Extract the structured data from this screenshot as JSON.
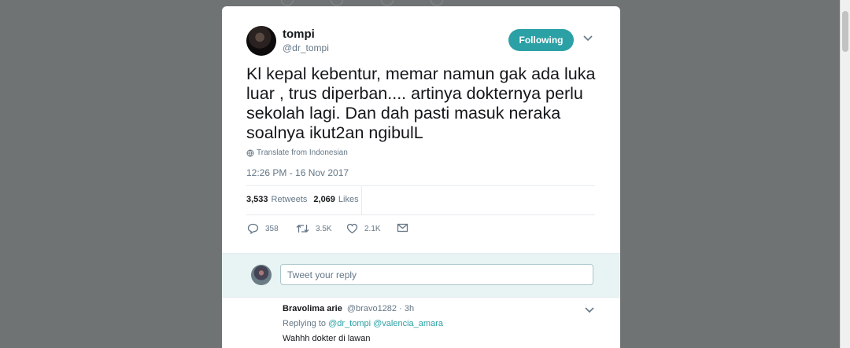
{
  "tweet": {
    "display_name": "tompi",
    "username": "@dr_tompi",
    "follow_label": "Following",
    "text": "Kl kepal kebentur, memar namun gak ada luka luar , trus diperban.... artinya dokternya perlu sekolah lagi. Dan dah pasti masuk neraka soalnya ikut2an ngibulL",
    "translate_label": "Translate from Indonesian",
    "timestamp": "12:26 PM - 16 Nov 2017",
    "stats": {
      "retweets_count": "3,533",
      "retweets_label": "Retweets",
      "likes_count": "2,069",
      "likes_label": "Likes"
    },
    "actions": {
      "reply_count": "358",
      "retweet_count": "3.5K",
      "like_count": "2.1K"
    }
  },
  "reply_box": {
    "placeholder": "Tweet your reply"
  },
  "replies": [
    {
      "name": "Bravolima arie",
      "handle": "@bravo1282",
      "time": "· 3h",
      "replying_prefix": "Replying to",
      "mention1": "@dr_tompi",
      "mention2": "@valencia_amara",
      "text": "Wahhh dokter di lawan"
    }
  ],
  "colors": {
    "accent": "#2ba1a6",
    "overlay": "#6f7374",
    "secondary_text": "#657786"
  },
  "icons": [
    "globe-icon",
    "chevron-down-icon",
    "reply-icon",
    "retweet-icon",
    "heart-icon",
    "envelope-icon"
  ]
}
